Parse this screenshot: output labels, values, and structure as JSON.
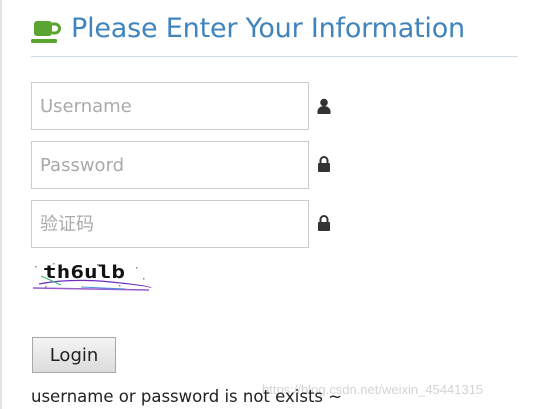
{
  "header": {
    "title": "Please Enter Your Information",
    "icon": "coffee-cup-icon",
    "title_color": "#3f84bd"
  },
  "form": {
    "username": {
      "placeholder": "Username",
      "value": "",
      "icon": "user-icon"
    },
    "password": {
      "placeholder": "Password",
      "value": "",
      "icon": "lock-icon"
    },
    "captcha_input": {
      "placeholder": "验证码",
      "value": "",
      "icon": "lock-icon"
    },
    "captcha_image_text": "th6ulb",
    "login_label": "Login"
  },
  "message": "username or password is not exists ~",
  "watermark": "https://blog.csdn.net/weixin_45441315"
}
